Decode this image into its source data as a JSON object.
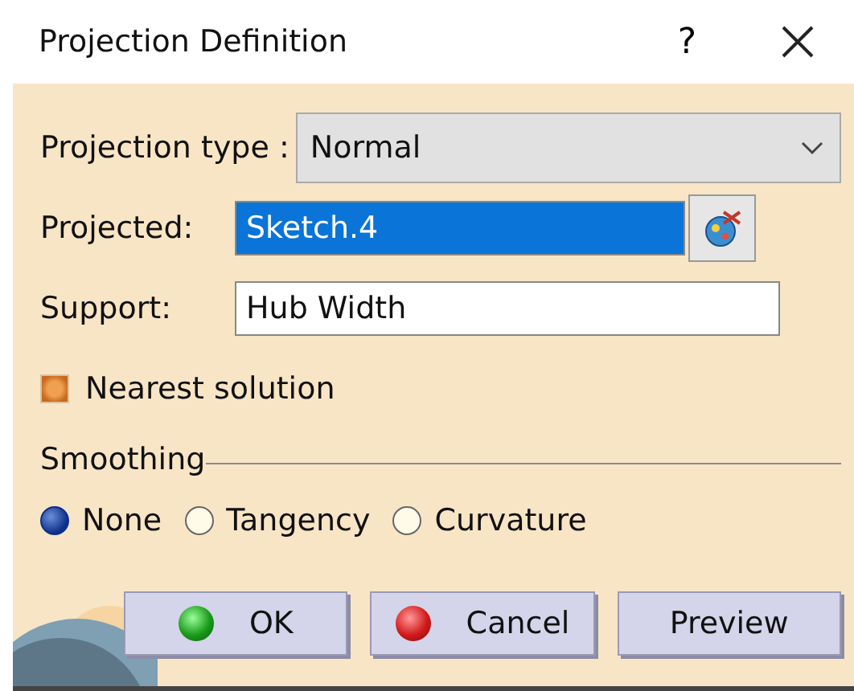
{
  "window": {
    "title": "Projection Definition",
    "help": "?"
  },
  "projection_type": {
    "label": "Projection type :",
    "value": "Normal"
  },
  "projected": {
    "label": "Projected:",
    "value": "Sketch.4",
    "selected": true
  },
  "support": {
    "label": "Support:",
    "value": "Hub Width"
  },
  "nearest_solution": {
    "label": "Nearest solution",
    "checked": true
  },
  "smoothing": {
    "title": "Smoothing",
    "options": [
      {
        "label": "None",
        "selected": true
      },
      {
        "label": "Tangency",
        "selected": false
      },
      {
        "label": "Curvature",
        "selected": false
      }
    ]
  },
  "buttons": [
    {
      "label": "OK",
      "kind": "ok"
    },
    {
      "label": "Cancel",
      "kind": "cancel"
    },
    {
      "label": "Preview",
      "kind": "plain"
    }
  ]
}
